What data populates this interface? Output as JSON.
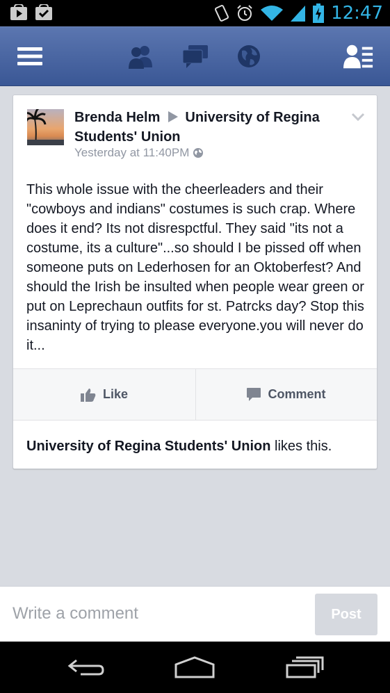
{
  "status_bar": {
    "time": "12:47",
    "icons": [
      "play-store-icon",
      "briefcase-check-icon",
      "vibrate-icon",
      "alarm-icon",
      "wifi-icon",
      "signal-icon",
      "battery-charging-icon"
    ],
    "accent_color": "#33b5e5"
  },
  "nav": {
    "color": "#3b5998",
    "buttons": [
      "menu-icon",
      "friend-requests-icon",
      "messages-icon",
      "notifications-globe-icon",
      "friends-list-icon"
    ]
  },
  "post": {
    "author": "Brenda Helm",
    "target": "University of Regina Students' Union",
    "timestamp": "Yesterday at 11:40PM",
    "privacy_icon": "public-globe-icon",
    "body": "This whole issue with the cheerleaders and their \"cowboys and indians\" costumes is such crap. Where does it end? Its not disrespctful. They said \"its not a costume, its a culture\"...so should I be pissed off when someone puts on Lederhosen for an Oktoberfest? And should the Irish be insulted when people wear green or put on Leprechaun outfits for st. Patrcks day? Stop this insaninty of trying to please everyone.you will never do it...",
    "like_label": "Like",
    "comment_label": "Comment",
    "likes_actor": "University of Regina Students' Union",
    "likes_suffix": " likes this."
  },
  "composer": {
    "placeholder": "Write a comment",
    "post_label": "Post"
  },
  "system_nav": [
    "back-icon",
    "home-icon",
    "recent-apps-icon"
  ]
}
